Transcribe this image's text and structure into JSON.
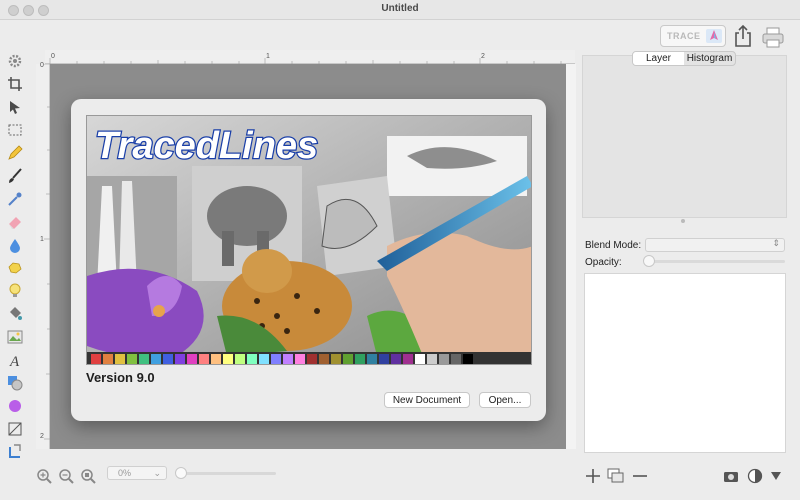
{
  "window": {
    "title": "Untitled"
  },
  "toolbar": {
    "trace_label": "TRACE"
  },
  "ruler": {
    "marks": [
      "0",
      "1",
      "2"
    ]
  },
  "splash": {
    "logo_text": "TracedLines",
    "version": "Version 9.0",
    "new_document_label": "New Document",
    "open_label": "Open..."
  },
  "zoom": {
    "value": "0%"
  },
  "inspector": {
    "tabs": [
      "Layer",
      "Histogram"
    ],
    "active_tab": "Layer",
    "blend_mode_label": "Blend Mode:",
    "blend_mode_value": "",
    "opacity_label": "Opacity:",
    "opacity_value": 0
  },
  "tools": [
    "gear-icon",
    "crop-icon",
    "arrow-icon",
    "marquee-icon",
    "pencil-icon",
    "brush-icon",
    "eyedropper-icon",
    "eraser-icon",
    "fill-icon",
    "lasso-icon",
    "bulb-icon",
    "bucket-icon",
    "image-icon",
    "text-icon",
    "shapes-icon",
    "color-icon",
    "transform-icon",
    "rotate-icon"
  ],
  "colors": {
    "accent": "#3b8cf0",
    "canvas": "#8c8c8c"
  }
}
